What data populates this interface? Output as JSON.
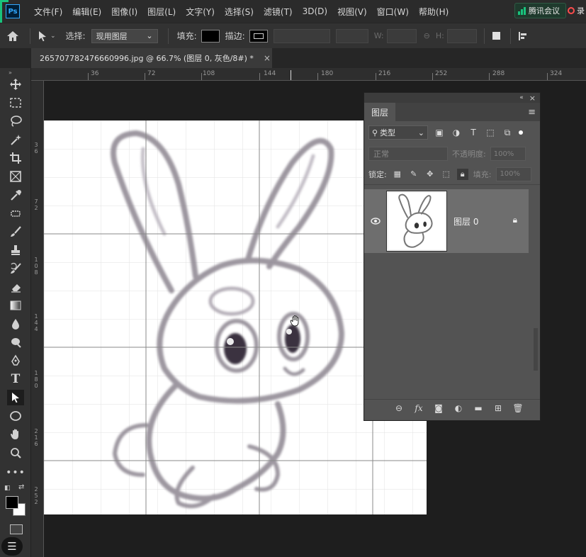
{
  "app": {
    "logo": "Ps"
  },
  "menu": [
    "文件(F)",
    "编辑(E)",
    "图像(I)",
    "图层(L)",
    "文字(Y)",
    "选择(S)",
    "滤镜(T)",
    "3D(D)",
    "视图(V)",
    "窗口(W)",
    "帮助(H)"
  ],
  "tray": {
    "tencent_label": "腾讯会议",
    "record_label": "录"
  },
  "options_bar": {
    "select_label": "选择:",
    "select_value": "现用图层",
    "fill_label": "填充:",
    "stroke_label": "描边:",
    "w_label": "W:",
    "h_label": "H:"
  },
  "document_tab": {
    "title": "265707782476660996.jpg @ 66.7% (图层 0, 灰色/8#) *",
    "close": "×"
  },
  "ruler_top_labels": [
    "36",
    "72",
    "108",
    "144",
    "180",
    "216",
    "252",
    "288",
    "324"
  ],
  "ruler_left_labels": [
    "3 6",
    "7 2",
    "1 0 8",
    "1 4 4",
    "1 8 0",
    "2 1 6",
    "2 5 2"
  ],
  "layers_panel": {
    "title": "图层",
    "filter_value": "类型",
    "blend_mode": "正常",
    "opacity_label": "不透明度:",
    "opacity_value": "100%",
    "lock_label": "锁定:",
    "fill_label": "填充:",
    "fill_value": "100%",
    "layers": [
      {
        "name": "图层 0",
        "visible": true,
        "locked": true
      }
    ]
  },
  "colors": {
    "accent_green": "#19c37d",
    "panel_bg": "#535353",
    "layer_selected": "#6e6e6e"
  }
}
